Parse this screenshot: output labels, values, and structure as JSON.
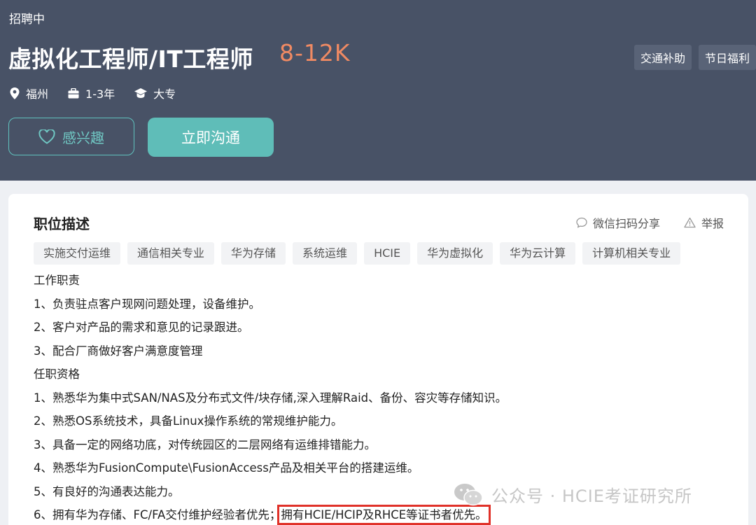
{
  "header": {
    "status": "招聘中",
    "title": "虚拟化工程师/IT工程师",
    "salary": "8-12K",
    "benefits": [
      "交通补助",
      "节日福利"
    ],
    "meta": {
      "city": "福州",
      "experience": "1-3年",
      "education": "大专"
    },
    "buttons": {
      "interest": "感兴趣",
      "chat": "立即沟通"
    }
  },
  "colors": {
    "header_bg": "#485266",
    "accent": "#5fbdb8",
    "salary": "#f08a63",
    "highlight": "#e03129"
  },
  "card": {
    "title": "职位描述",
    "share_label": "微信扫码分享",
    "report_label": "举报",
    "tags": [
      "实施交付运维",
      "通信相关专业",
      "华为存储",
      "系统运维",
      "HCIE",
      "华为虚拟化",
      "华为云计算",
      "计算机相关专业"
    ],
    "lines": [
      "工作职责",
      "1、负责驻点客户现网问题处理，设备维护。",
      "2、客户对产品的需求和意见的记录跟进。",
      "3、配合厂商做好客户满意度管理",
      "任职资格",
      "1、熟悉华为集中式SAN/NAS及分布式文件/块存储,深入理解Raid、备份、容灾等存储知识。",
      "2、熟悉OS系统技术，具备Linux操作系统的常规维护能力。",
      "3、具备一定的网络功底，对传统园区的二层网络有运维排错能力。",
      "4、熟悉华为FusionCompute\\FusionAccess产品及相关平台的搭建运维。",
      "5、有良好的沟通表达能力。"
    ],
    "last_line_start": "6、拥有华为存储、FC/FA交付维护经验者优先；",
    "last_line_highlight": "拥有HCIE/HCIP及RHCE等证书者优先。"
  },
  "watermark": "公众号 · HCIE考证研究所"
}
